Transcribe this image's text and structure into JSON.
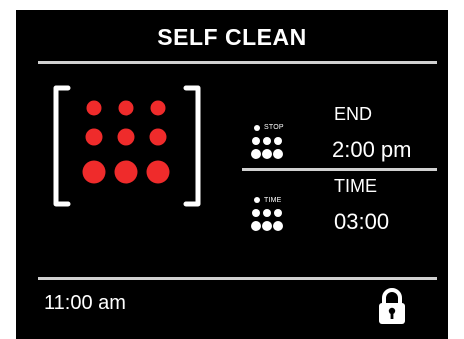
{
  "header": {
    "title": "SELF CLEAN"
  },
  "status": {
    "end_label": "END",
    "end_value": "2:00 pm",
    "stop_caption": "STOP",
    "time_label": "TIME",
    "time_value": "03:00",
    "time_caption": "TIME"
  },
  "footer": {
    "clock": "11:00 am"
  },
  "icons": {
    "burner": "burner-dots-icon",
    "stop": "stop-dots-icon",
    "timer": "timer-dots-icon",
    "lock": "lock-icon"
  },
  "colors": {
    "accent": "#ef2b2b",
    "background": "#000000",
    "text": "#ffffff"
  }
}
